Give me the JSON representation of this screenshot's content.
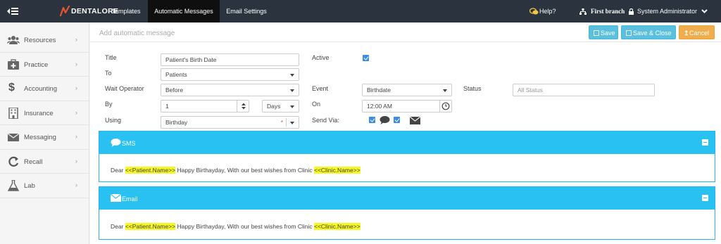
{
  "app": {
    "brand": "DENTALORE"
  },
  "nav": {
    "tabs": [
      {
        "label": "Templates"
      },
      {
        "label": "Automatic Messages"
      },
      {
        "label": "Email Settings"
      }
    ],
    "help_label": "Help?",
    "branch_label": "First branch",
    "user_label": "System Administrator"
  },
  "sidebar": {
    "items": [
      {
        "label": "Resources",
        "icon": "users-icon"
      },
      {
        "label": "Practice",
        "icon": "medical-kit-icon"
      },
      {
        "label": "Accounting",
        "icon": "dollar-icon"
      },
      {
        "label": "Insurance",
        "icon": "building-icon"
      },
      {
        "label": "Messaging",
        "icon": "envelope-icon"
      },
      {
        "label": "Recall",
        "icon": "refresh-icon"
      },
      {
        "label": "Lab",
        "icon": "flask-icon"
      }
    ]
  },
  "page": {
    "title": "Add automatic message"
  },
  "toolbar": {
    "save_label": "Save",
    "save_close_label": "Save & Close",
    "cancel_label": "Cancel"
  },
  "form": {
    "title": {
      "label": "Title",
      "value": "Patient's Birth Date"
    },
    "to": {
      "label": "To",
      "value": "Patients"
    },
    "wait_operator": {
      "label": "Wait Operator",
      "value": "Before"
    },
    "by": {
      "label": "By",
      "value": "1",
      "unit": "Days"
    },
    "using": {
      "label": "Using",
      "value": "Birthday",
      "required_mark": "*"
    },
    "active": {
      "label": "Active",
      "checked": true
    },
    "event": {
      "label": "Event",
      "value": "Birthdate"
    },
    "on": {
      "label": "On",
      "value": "12:00 AM"
    },
    "send_via": {
      "label": "Send Via:",
      "sms": true,
      "email": true
    },
    "status": {
      "label": "Status",
      "placeholder": "All Status"
    }
  },
  "panels": {
    "sms": {
      "title": "SMS",
      "body_prefix": "Dear ",
      "token1": "<<Patient.Name>>",
      "body_middle": " Happy Birthayday, With our best wishes from Clinic ",
      "token2": "<<Clinic.Name>>"
    },
    "email": {
      "title": "Email",
      "body_prefix": "Dear ",
      "token1": "<<Patient.Name>>",
      "body_middle": " Happy Birthayday, With our best wishes from Clinic ",
      "token2": "<<Clinic.Name>>"
    }
  },
  "colors": {
    "topbar": "#2b333e",
    "accent_blue": "#5bc0de",
    "panel_blue": "#29c0f2",
    "cancel_orange": "#f0ad4e",
    "highlight": "#f7f722"
  }
}
